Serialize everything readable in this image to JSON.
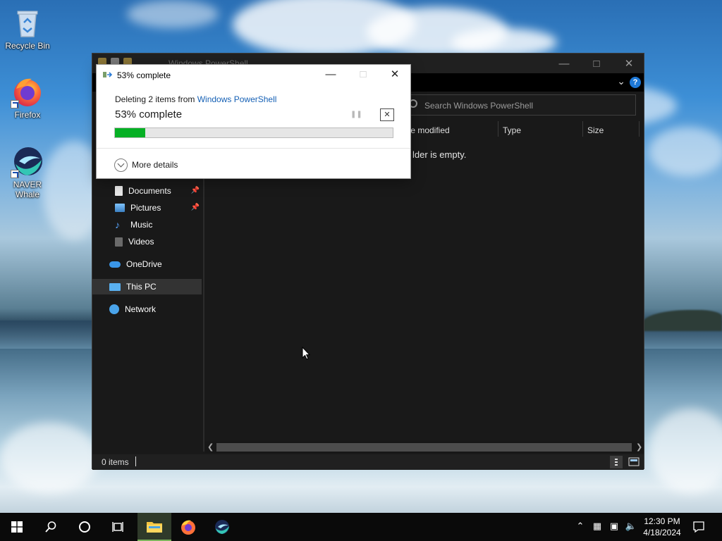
{
  "desktop": {
    "icons": [
      {
        "label": "Recycle Bin"
      },
      {
        "label": "Firefox"
      },
      {
        "label": "NAVER Whale"
      }
    ]
  },
  "explorer": {
    "title": "Windows PowerShell",
    "search_placeholder": "Search Windows PowerShell",
    "help_label": "?",
    "columns": [
      "te modified",
      "Type",
      "Size"
    ],
    "empty_message": "lder is empty.",
    "nav_items": [
      {
        "label": "Documents",
        "pinned": true
      },
      {
        "label": "Pictures",
        "pinned": true
      },
      {
        "label": "Music",
        "pinned": false
      },
      {
        "label": "Videos",
        "pinned": false
      },
      {
        "label": "OneDrive",
        "pinned": false
      },
      {
        "label": "This PC",
        "pinned": false,
        "selected": true
      },
      {
        "label": "Network",
        "pinned": false
      }
    ],
    "status": "0 items"
  },
  "progress_dialog": {
    "title": "53% complete",
    "description_prefix": "Deleting 2 items from ",
    "description_link": "Windows PowerShell",
    "percent_text": "53% complete",
    "progress_fraction": 0.11,
    "more_details_label": "More details"
  },
  "taskbar": {
    "buttons": [
      "start",
      "search",
      "cortana",
      "task-view",
      "file-explorer",
      "firefox",
      "naver-whale"
    ],
    "active_button": "file-explorer",
    "clock_time": "12:30 PM",
    "clock_date": "4/18/2024"
  },
  "colors": {
    "progress_fill": "#06b025",
    "link": "#1560b5",
    "taskbar": "#0a0a0a",
    "explorer_bg": "#191919"
  }
}
